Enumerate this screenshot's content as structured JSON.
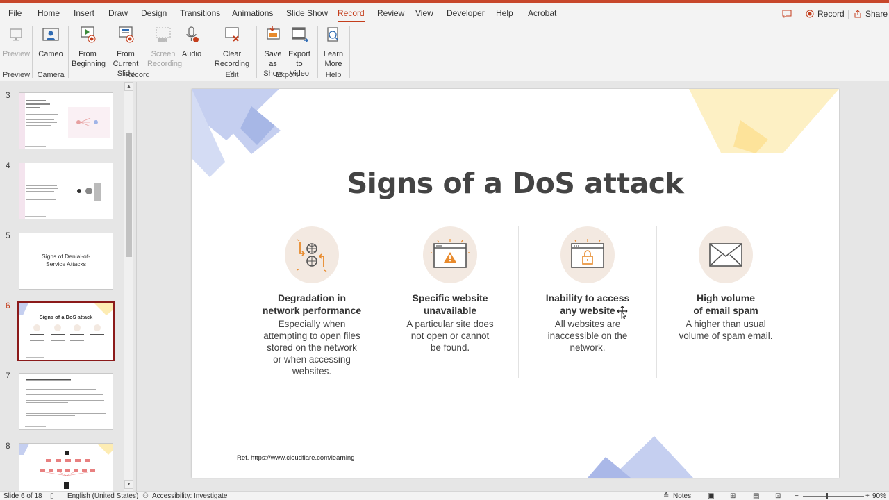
{
  "tabs": [
    "File",
    "Home",
    "Insert",
    "Draw",
    "Design",
    "Transitions",
    "Animations",
    "Slide Show",
    "Record",
    "Review",
    "View",
    "Developer",
    "Help",
    "Acrobat"
  ],
  "active_tab": "Record",
  "titlebar_actions": {
    "record_label": "Record",
    "share_label": "Share"
  },
  "ribbon": {
    "preview_label": "Preview",
    "cameo_label": "Cameo",
    "from_beginning": [
      "From",
      "Beginning"
    ],
    "from_current": [
      "From",
      "Current Slide"
    ],
    "screen_recording": [
      "Screen",
      "Recording"
    ],
    "audio_label": "Audio",
    "clear_recording": [
      "Clear",
      "Recording"
    ],
    "save_as_show": [
      "Save as",
      "Show"
    ],
    "export_to_video": [
      "Export",
      "to Video"
    ],
    "learn_more": [
      "Learn",
      "More"
    ],
    "groups": {
      "preview": "Preview",
      "camera": "Camera",
      "record": "Record",
      "edit": "Edit",
      "export": "Export",
      "help": "Help"
    }
  },
  "slides_pane": {
    "numbers": [
      "3",
      "4",
      "5",
      "6",
      "7",
      "8"
    ],
    "active": "6",
    "thumb5_title": [
      "Signs of Denial-of-",
      "Service Attacks"
    ],
    "thumb6_title": "Signs of a DoS attack"
  },
  "slide": {
    "title": "Signs of a DoS attack",
    "columns": [
      {
        "heading": [
          "Degradation in",
          "network performance"
        ],
        "body": [
          "Especially when",
          "attempting to open files",
          "stored on the network",
          "or when accessing",
          "websites."
        ]
      },
      {
        "heading": [
          "Specific website",
          "unavailable"
        ],
        "body": [
          "A particular site does",
          "not open or cannot",
          "be found."
        ]
      },
      {
        "heading": [
          "Inability to access",
          "any website"
        ],
        "body": [
          "All websites are",
          "inaccessible on the",
          "network."
        ]
      },
      {
        "heading": [
          "High volume",
          "of email spam"
        ],
        "body": [
          "A higher than usual",
          "volume of spam email."
        ]
      }
    ],
    "reference": "Ref.  https://www.cloudflare.com/learning"
  },
  "status_bar": {
    "slide_counter": "Slide 6 of 18",
    "language": "English (United States)",
    "accessibility": "Accessibility: Investigate",
    "notes": "Notes",
    "zoom": "90%"
  },
  "colors": {
    "accent": "#c43e1c",
    "icon_orange": "#e88a2c",
    "circle_bg": "#f3e9e1",
    "deco_blue": "#aab8e8",
    "deco_yellow": "#fde9a3"
  }
}
